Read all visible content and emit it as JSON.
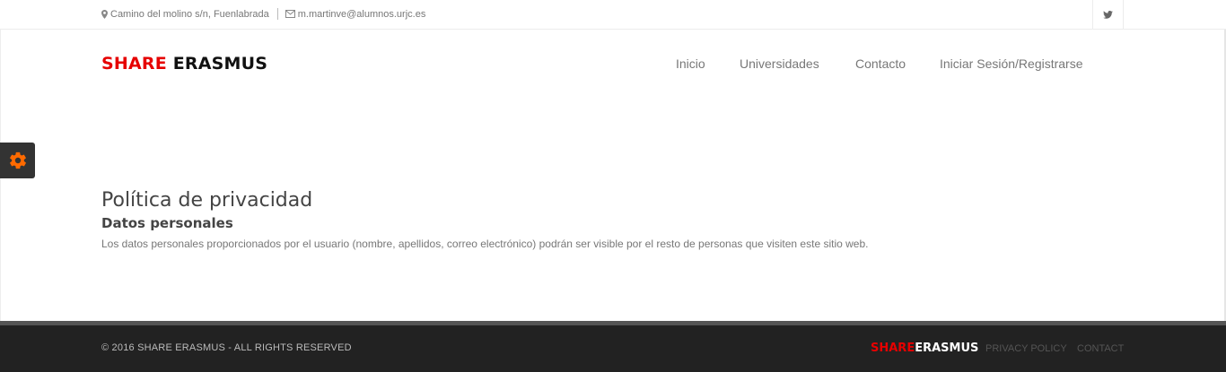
{
  "topbar": {
    "address": "Camino del molino s/n, Fuenlabrada",
    "email": "m.martinve@alumnos.urjc.es",
    "social_icon": "twitter-icon"
  },
  "header": {
    "logo_part1": "SHARE",
    "logo_part2": "ERASMUS",
    "nav": {
      "inicio": "Inicio",
      "universidades": "Universidades",
      "contacto": "Contacto",
      "login": "Iniciar Sesión/Registrarse"
    }
  },
  "settings": {
    "icon": "gear-icon",
    "color": "#ff6a00"
  },
  "main": {
    "title": "Política de privacidad",
    "subtitle": "Datos personales",
    "text": "Los datos personales proporcionados por el usuario (nombre, apellidos, correo electrónico) podrán ser visible por el resto de personas que visiten este sitio web."
  },
  "footer": {
    "copyright": "© 2016 SHARE ERASMUS - ALL RIGHTS RESERVED",
    "logo_part1": "SHARE",
    "logo_part2": "ERASMUS",
    "privacy": "PRIVACY POLICY",
    "contact": "CONTACT"
  },
  "colors": {
    "brand_red": "#e60000",
    "footer_bg": "#222222"
  }
}
